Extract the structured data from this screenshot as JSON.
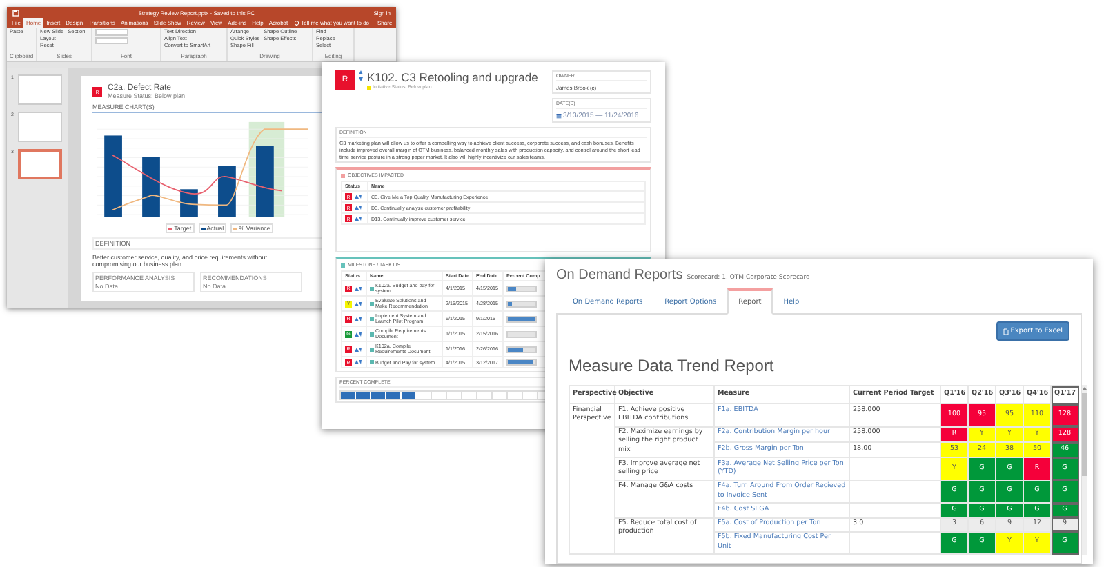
{
  "powerpoint_window": {
    "title": "Strategy Review Report.pptx - Saved to this PC",
    "account": "Sign in",
    "tabs": [
      {
        "label": "File",
        "selected": false
      },
      {
        "label": "Home",
        "selected": true
      },
      {
        "label": "Insert",
        "selected": false
      },
      {
        "label": "Design",
        "selected": false
      },
      {
        "label": "Transitions",
        "selected": false
      },
      {
        "label": "Animations",
        "selected": false
      },
      {
        "label": "Slide Show",
        "selected": false
      },
      {
        "label": "Review",
        "selected": false
      },
      {
        "label": "View",
        "selected": false
      },
      {
        "label": "Add-ins",
        "selected": false
      },
      {
        "label": "Help",
        "selected": false
      },
      {
        "label": "Acrobat",
        "selected": false
      }
    ],
    "tell_me": "Tell me what you want to do",
    "share": "Share",
    "ribbon_groups": [
      {
        "label": "Clipboard",
        "buttons": [
          "Paste"
        ]
      },
      {
        "label": "Slides",
        "buttons": [
          "New Slide",
          "Layout",
          "Reset",
          "Section"
        ]
      },
      {
        "label": "Font"
      },
      {
        "label": "Paragraph",
        "buttons": [
          "Text Direction",
          "Align Text",
          "Convert to SmartArt"
        ]
      },
      {
        "label": "Drawing",
        "buttons": [
          "Arrange",
          "Quick Styles",
          "Shape Fill",
          "Shape Outline",
          "Shape Effects"
        ]
      },
      {
        "label": "Editing",
        "buttons": [
          "Find",
          "Replace",
          "Select"
        ]
      }
    ],
    "thumbnails": [
      {
        "number": "1",
        "selected": false
      },
      {
        "number": "2",
        "selected": false
      },
      {
        "number": "3",
        "selected": true
      }
    ],
    "slide": {
      "logo": "R",
      "title": "C2a. Defect Rate",
      "subtitle": "Measure Status: Below plan",
      "section": "MEASURE CHART(S)",
      "legend": [
        {
          "label": "Target",
          "color": "#e8606e"
        },
        {
          "label": "Actual",
          "color": "#0d4d8c"
        },
        {
          "label": "% Variance",
          "color": "#f0b880"
        }
      ],
      "definition_label": "DEFINITION",
      "definition": "Better customer service, quality, and price requirements without compromising our business plan.",
      "boxes": [
        {
          "label": "PERFORMANCE ANALYSIS",
          "value": "No Data"
        },
        {
          "label": "RECOMMENDATIONS",
          "value": "No Data"
        }
      ]
    }
  },
  "initiative_window": {
    "logo": "R",
    "title": "K102. C3 Retooling and upgrade",
    "status": "Initiative Status: Below plan",
    "owner_label": "OWNER",
    "owner": "James Brook (c)",
    "dates_label": "DATE(S)",
    "dates": "3/13/2015 — 11/24/2016",
    "definition_label": "DEFINITION",
    "definition": "C3 marketing plan will allow us to offer a compelling way to achieve client success, corporate success, and cash bonuses. Benefits include improved overall margin of OTM business, balanced monthly sales with production capacity, and control around the short lead time service posture in a strong paper market. It also will highly incentivize our sales teams.",
    "objectives": {
      "label": "OBJECTIVES IMPACTED",
      "columns": [
        "Status",
        "Name"
      ],
      "rows": [
        {
          "status": "R",
          "color": "#e8112d",
          "name": "C3. Give Me a Top Quality Manufacturing Experience"
        },
        {
          "status": "R",
          "color": "#e8112d",
          "name": "D3. Continually analyze customer profitability"
        },
        {
          "status": "R",
          "color": "#e8112d",
          "name": "D13. Continually improve customer service"
        }
      ]
    },
    "milestones": {
      "label": "MILESTONE / TASK LIST",
      "columns": [
        "Status",
        "Name",
        "Start Date",
        "End Date",
        "Percent Comp"
      ],
      "rows": [
        {
          "status": "R",
          "color": "#e8112d",
          "name": "K102a. Budget and pay for system",
          "start": "4/1/2015",
          "end": "4/15/2015",
          "level": 0.3
        },
        {
          "status": "Y",
          "color": "#f5f500",
          "name": "Evaluate Solutions and Make Recommendation",
          "start": "2/15/2015",
          "end": "4/28/2015",
          "level": 0.15
        },
        {
          "status": "R",
          "color": "#e8112d",
          "name": "Implement System and Launch Pilot Program",
          "start": "6/1/2015",
          "end": "9/1/2015",
          "level": 1
        },
        {
          "status": "G",
          "color": "#1a9a3a",
          "name": "Compile Requirements Document",
          "start": "1/1/2015",
          "end": "2/15/2016",
          "level": 0
        },
        {
          "status": "R",
          "color": "#e8112d",
          "name": "K102a. Compile Requirements Document",
          "start": "1/1/2016",
          "end": "2/26/2016",
          "level": 0.55
        },
        {
          "status": "R",
          "color": "#e8112d",
          "name": "Budget and Pay for system",
          "start": "4/1/2015",
          "end": "3/12/2017",
          "level": 0.9
        }
      ]
    },
    "percent_complete": {
      "label": "PERCENT COMPLETE",
      "level": 0.36
    }
  },
  "reports_window": {
    "title": "On Demand Reports",
    "subtitle": "Scorecard: 1. OTM Corporate Scorecard",
    "tabs": [
      {
        "label": "On Demand Reports",
        "selected": false
      },
      {
        "label": "Report Options",
        "selected": false
      },
      {
        "label": "Report",
        "selected": true
      },
      {
        "label": "Help",
        "selected": false
      }
    ],
    "export_button": "Export to Excel",
    "heading": "Measure Data Trend Report",
    "columns": [
      {
        "label": "Perspective",
        "highlighted": false
      },
      {
        "label": "Objective",
        "highlighted": false
      },
      {
        "label": "Measure",
        "highlighted": false
      },
      {
        "label": "Current Period Target",
        "highlighted": false
      },
      {
        "label": "Q1'16",
        "highlighted": false
      },
      {
        "label": "Q2'16",
        "highlighted": false
      },
      {
        "label": "Q3'16",
        "highlighted": false
      },
      {
        "label": "Q4'16",
        "highlighted": false
      },
      {
        "label": "Q1'17",
        "highlighted": true
      }
    ],
    "rows": [
      {
        "perspective": "Financial Perspective",
        "objective": "F1. Achieve positive EBITDA contributions",
        "measure": "F1a. EBITDA",
        "target": "258.000",
        "quarters": [
          {
            "text": "100",
            "color": "#f5003a"
          },
          {
            "text": "95",
            "color": "#f5003a"
          },
          {
            "text": "95",
            "color": "#ffff00"
          },
          {
            "text": "110",
            "color": "#ffff00"
          },
          {
            "text": "128",
            "color": "#f5003a"
          }
        ]
      },
      {
        "objective": "F2. Maximize earnings by selling the right product mix",
        "measure": "F2a. Contribution Margin per hour",
        "target": "258.000",
        "quarters": [
          {
            "text": "R",
            "color": "#f5003a"
          },
          {
            "text": "Y",
            "color": "#ffff00"
          },
          {
            "text": "Y",
            "color": "#ffff00"
          },
          {
            "text": "Y",
            "color": "#ffff00"
          },
          {
            "text": "128",
            "color": "#f5003a"
          }
        ]
      },
      {
        "measure": "F2b. Gross Margin per Ton",
        "target": "18.00",
        "quarters": [
          {
            "text": "53",
            "color": "#ffff00"
          },
          {
            "text": "24",
            "color": "#ffff00"
          },
          {
            "text": "38",
            "color": "#ffff00"
          },
          {
            "text": "50",
            "color": "#ffff00"
          },
          {
            "text": "46",
            "color": "#00983a"
          }
        ]
      },
      {
        "objective": "F3. Improve average net selling price",
        "measure": "F3a. Average Net Selling Price per Ton (YTD)",
        "quarters": [
          {
            "text": "Y",
            "color": "#ffff00"
          },
          {
            "text": "G",
            "color": "#00983a"
          },
          {
            "text": "G",
            "color": "#00983a"
          },
          {
            "text": "R",
            "color": "#f5003a"
          },
          {
            "text": "G",
            "color": "#00983a"
          }
        ]
      },
      {
        "objective": "F4. Manage G&A costs",
        "measure": "F4a. Turn Around From Order Recieved to Invoice Sent",
        "quarters": [
          {
            "text": "G",
            "color": "#00983a"
          },
          {
            "text": "G",
            "color": "#00983a"
          },
          {
            "text": "G",
            "color": "#00983a"
          },
          {
            "text": "G",
            "color": "#00983a"
          },
          {
            "text": "G",
            "color": "#00983a"
          }
        ]
      },
      {
        "measure": "F4b. Cost SEGA",
        "quarters": [
          {
            "text": "G",
            "color": "#00983a"
          },
          {
            "text": "G",
            "color": "#00983a"
          },
          {
            "text": "G",
            "color": "#00983a"
          },
          {
            "text": "G",
            "color": "#00983a"
          },
          {
            "text": "G",
            "color": "#00983a"
          }
        ]
      },
      {
        "objective": "F5. Reduce total cost of production",
        "measure": "F5a. Cost of Production per Ton",
        "target": "3.0",
        "quarters": [
          {
            "text": "3",
            "color": "#ececec"
          },
          {
            "text": "6",
            "color": "#ececec"
          },
          {
            "text": "9",
            "color": "#ececec"
          },
          {
            "text": "12",
            "color": "#ececec"
          },
          {
            "text": "9",
            "color": "#ececec"
          }
        ]
      },
      {
        "measure": "F5b. Fixed Manufacturing Cost Per Unit",
        "quarters": [
          {
            "text": "G",
            "color": "#00983a"
          },
          {
            "text": "G",
            "color": "#00983a"
          },
          {
            "text": "Y",
            "color": "#ffff00"
          },
          {
            "text": "Y",
            "color": "#ffff00"
          },
          {
            "text": "G",
            "color": "#00983a"
          }
        ]
      }
    ]
  }
}
